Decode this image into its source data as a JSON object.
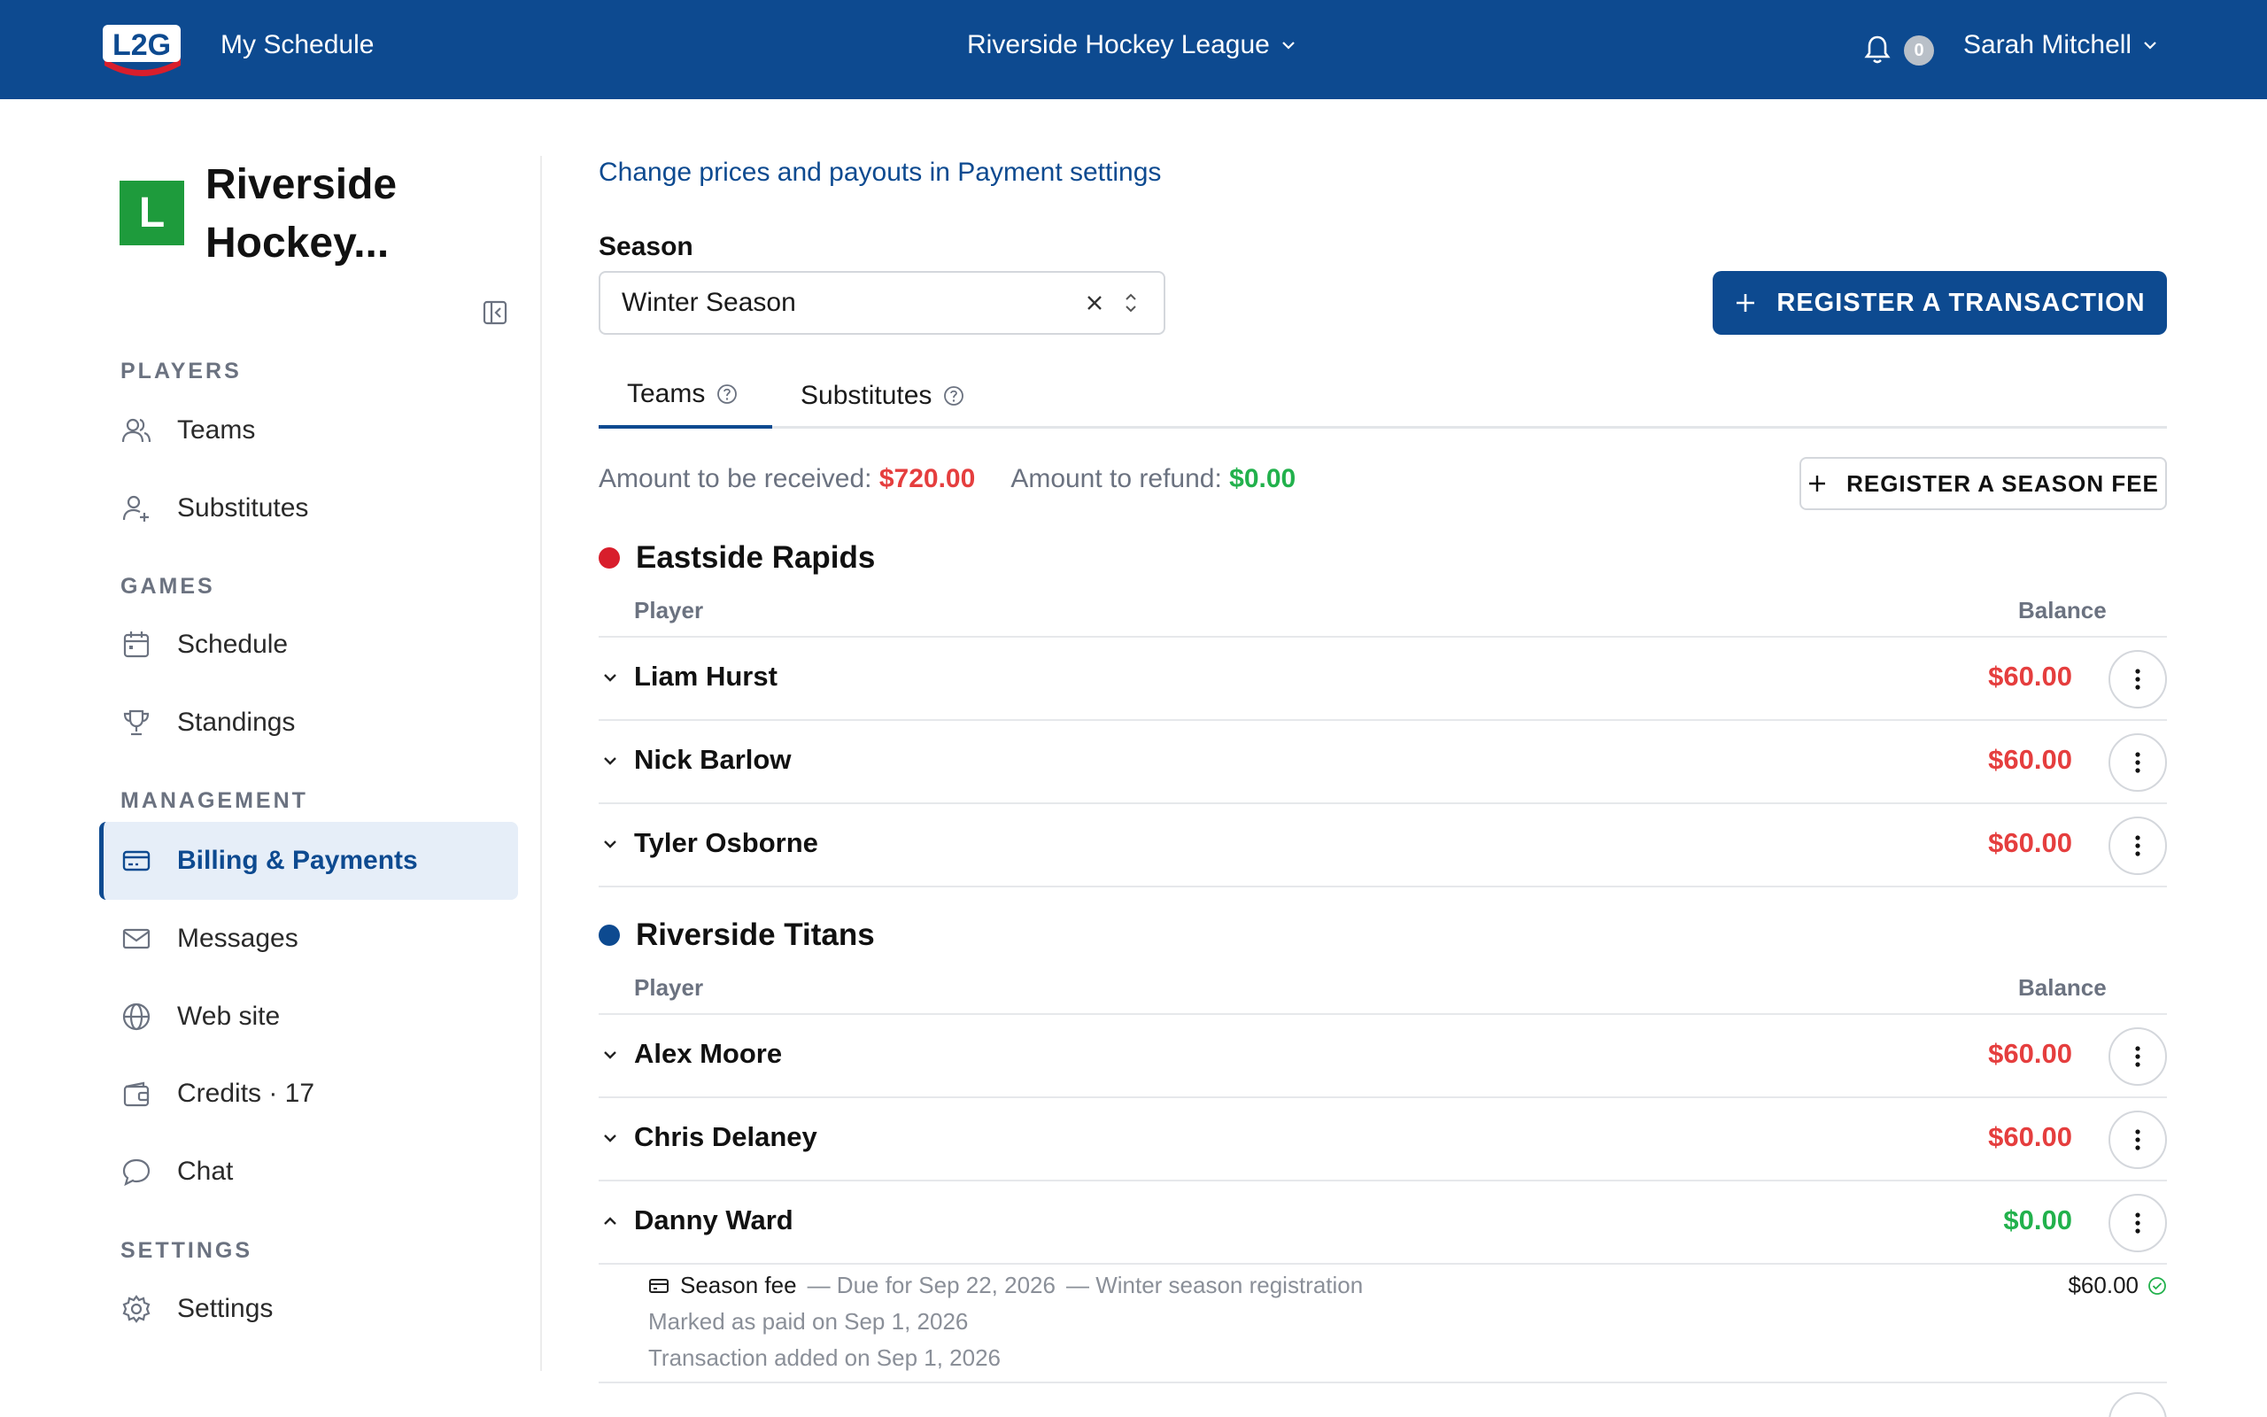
{
  "header": {
    "logo_text": "L2G",
    "nav_title": "My Schedule",
    "league": "Riverside Hockey League",
    "notification_count": "0",
    "user_name": "Sarah Mitchell"
  },
  "sidebar": {
    "org_initial": "L",
    "org_name": "Riverside Hockey...",
    "sections": {
      "players": "PLAYERS",
      "games": "GAMES",
      "management": "MANAGEMENT",
      "settings": "SETTINGS"
    },
    "items": {
      "teams": "Teams",
      "substitutes": "Substitutes",
      "schedule": "Schedule",
      "standings": "Standings",
      "billing": "Billing & Payments",
      "messages": "Messages",
      "website": "Web site",
      "credits": "Credits · 17",
      "chat": "Chat",
      "settings": "Settings"
    }
  },
  "main": {
    "settings_link": "Change prices and payouts in Payment settings",
    "season_label": "Season",
    "season_value": "Winter Season",
    "register_transaction": "REGISTER A TRANSACTION",
    "tabs": {
      "teams": "Teams",
      "substitutes": "Substitutes"
    },
    "summary": {
      "receive_label": "Amount to be received:",
      "receive_value": "$720.00",
      "refund_label": "Amount to refund:",
      "refund_value": "$0.00"
    },
    "register_season_fee": "REGISTER A SEASON FEE",
    "columns": {
      "player": "Player",
      "balance": "Balance"
    },
    "teams": [
      {
        "name": "Eastside Rapids",
        "color": "#d81e2c",
        "players": [
          {
            "name": "Liam Hurst",
            "balance": "$60.00"
          },
          {
            "name": "Nick Barlow",
            "balance": "$60.00"
          },
          {
            "name": "Tyler Osborne",
            "balance": "$60.00"
          }
        ]
      },
      {
        "name": "Riverside Titans",
        "color": "#0d4a90",
        "players": [
          {
            "name": "Alex Moore",
            "balance": "$60.00"
          },
          {
            "name": "Chris Delaney",
            "balance": "$60.00"
          },
          {
            "name": "Danny Ward",
            "balance": "$0.00"
          }
        ]
      }
    ],
    "expanded_detail": {
      "fee_label": "Season fee",
      "due": "— Due for Sep 22, 2026",
      "note": "— Winter season registration",
      "paid": "Marked as paid on Sep 1, 2026",
      "added": "Transaction added on Sep 1, 2026",
      "amount": "$60.00"
    }
  },
  "colors": {
    "brand": "#0d4a90",
    "owed": "#e53e3e",
    "settled": "#22b14c"
  }
}
